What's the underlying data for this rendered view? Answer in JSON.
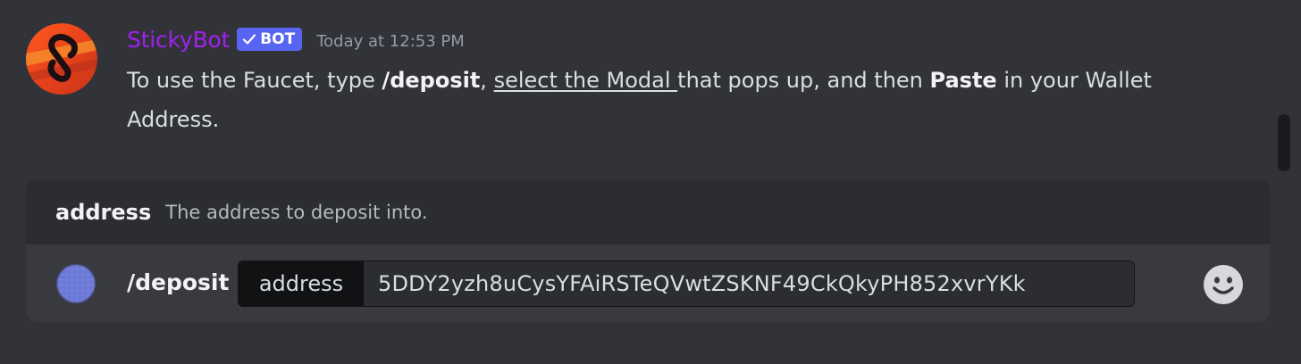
{
  "message": {
    "author": "StickyBot",
    "author_color": "#a020f0",
    "bot_tag": "BOT",
    "bot_tag_color": "#5865f2",
    "timestamp": "Today at 12:53 PM",
    "text": {
      "part1": "To use the Faucet, type ",
      "command": "/deposit",
      "part2": ", ",
      "underlined": "select the Modal ",
      "part3": "that pops up, and then ",
      "bold": "Paste",
      "part4": " in your Wallet Address."
    },
    "avatar_icon": "stickybot-logo-icon"
  },
  "composer": {
    "option_hint": {
      "name": "address",
      "description": "The address to deposit into."
    },
    "command": "/deposit",
    "option": {
      "key": "address",
      "value": "5DDY2yzh8uCysYFAiRSTeQVwtZSKNF49CkQkyPH852xvrYKk"
    },
    "app_icon": "bot-avatar-icon",
    "emoji_icon": "emoji-smile-icon"
  }
}
